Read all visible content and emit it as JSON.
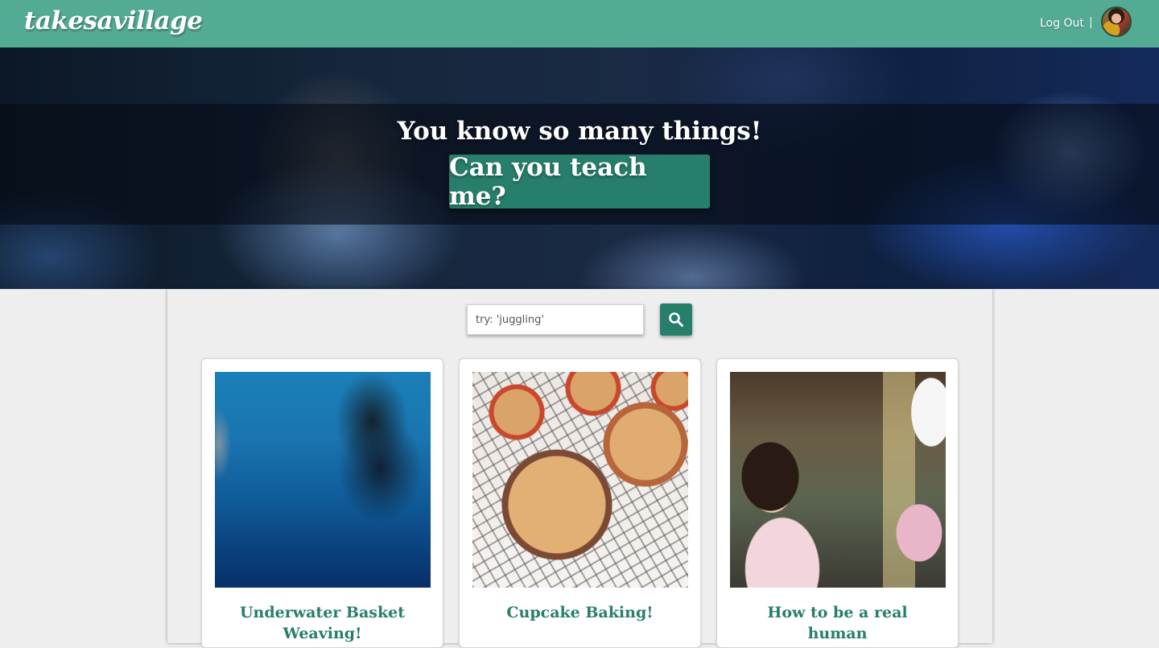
{
  "header": {
    "logo": "takesavillage",
    "logout_label": "Log Out",
    "separator": "|",
    "avatar_alt": "user avatar"
  },
  "hero": {
    "title": "You know so many things!",
    "cta_label": "Can you teach me?"
  },
  "search": {
    "placeholder": "try: 'juggling'",
    "value": "",
    "button_icon": "search-icon"
  },
  "cards": [
    {
      "title": "Underwater Basket Weaving!",
      "image": "scuba-diver-photo"
    },
    {
      "title": "Cupcake Baking!",
      "image": "blueberry-muffins-photo"
    },
    {
      "title": "How to be a real human",
      "image": "girl-and-robot-photo"
    }
  ],
  "colors": {
    "brand": "#53ab93",
    "accent": "#277e6a",
    "background": "#eeeeee"
  }
}
